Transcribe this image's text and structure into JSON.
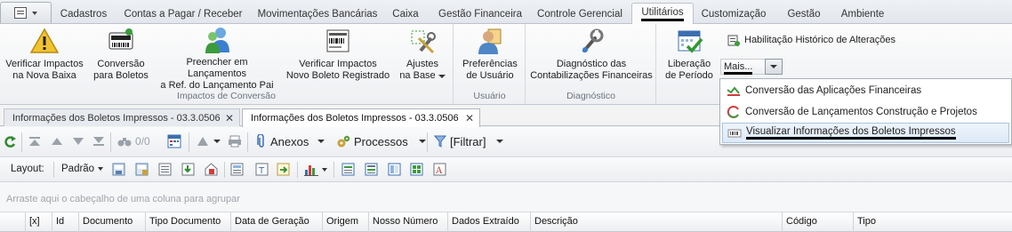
{
  "ribbon_tabs": [
    "Cadastros",
    "Contas a Pagar / Receber",
    "Movimentações Bancárias",
    "Caixa",
    "Gestão Financeira",
    "Controle Gerencial",
    "Utilitários",
    "Customização",
    "Gestão",
    "Ambiente"
  ],
  "active_tab": "Utilitários",
  "groups": {
    "impactos": {
      "label": "Impactos de Conversão",
      "buttons": [
        {
          "line1": "Verificar Impactos",
          "line2": "na Nova Baixa",
          "icon": "warning-icon"
        },
        {
          "line1": "Conversão",
          "line2": "para Boletos",
          "icon": "boleto-icon"
        },
        {
          "line1": "Preencher em Lançamentos",
          "line2": "a Ref. do Lançamento Pai",
          "icon": "users-icon"
        },
        {
          "line1": "Verificar Impactos",
          "line2": "Novo Boleto Registrado",
          "icon": "barcode-report-icon"
        },
        {
          "line1": "Ajustes",
          "line2": "na Base",
          "icon": "tools-icon"
        }
      ]
    },
    "usuario": {
      "label": "Usuário",
      "buttons": [
        {
          "line1": "Preferências",
          "line2": "de Usuário",
          "icon": "user-preferences-icon"
        }
      ]
    },
    "diagnostico": {
      "label": "Diagnóstico",
      "buttons": [
        {
          "line1": "Diagnóstico das",
          "line2": "Contabilizações Financeiras",
          "icon": "wrench-icon"
        }
      ]
    },
    "utilitarios": {
      "liberacao": {
        "line1": "Liberação",
        "line2": "de Período",
        "icon": "calendar-check-icon"
      },
      "habilitacao": "Habilitação Histórico de Alterações",
      "mais": "Mais..."
    }
  },
  "mais_menu": [
    {
      "label": "Conversão das Aplicações Financeiras",
      "icon": "chart-arrow-icon"
    },
    {
      "label": "Conversão de Lançamentos Construção e Projetos",
      "icon": "refresh-ring-icon"
    },
    {
      "label": "Visualizar Informações dos Boletos Impressos",
      "icon": "boleto-small-icon",
      "highlighted": true
    }
  ],
  "document_tabs": [
    {
      "label": "Informações dos Boletos Impressos - 03.3.0506",
      "active": false
    },
    {
      "label": "Informações dos Boletos Impressos - 03.3.0506",
      "active": true
    }
  ],
  "toolbar": {
    "record_count": "0/0",
    "anexos": "Anexos",
    "processos": "Processos",
    "filtrar": "[Filtrar]",
    "layout_label": "Layout:",
    "layout_value": "Padrão"
  },
  "grid": {
    "group_hint": "Arraste aqui o cabeçalho de uma coluna para agrupar",
    "columns": [
      "[x]",
      "Id",
      "Documento",
      "Tipo Documento",
      "Data de Geração",
      "Origem",
      "Nosso Número",
      "Dados Extraído",
      "Descrição",
      "Código",
      "Tipo"
    ]
  },
  "colors": {
    "accent": "#3c7fd0",
    "highlight": "#dde9f7",
    "warning": "#f2c230",
    "green": "#3c9b3c"
  }
}
